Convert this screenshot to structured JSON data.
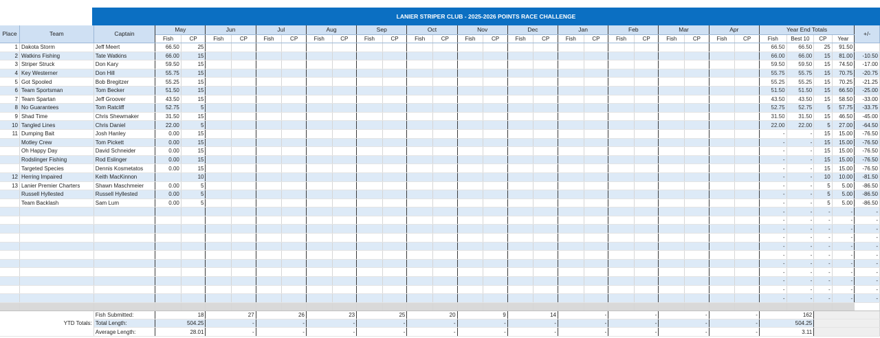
{
  "title": "LANIER STRIPER CLUB - 2025-2026 POINTS RACE CHALLENGE",
  "headers": {
    "place": "Place",
    "team": "Team",
    "captain": "Captain",
    "year_end_totals": "Year End Totals",
    "plus_minus": "+/-",
    "fish": "Fish",
    "cp": "CP",
    "best10": "Best 10",
    "year": "Year"
  },
  "months": [
    "May",
    "Jun",
    "Jul",
    "Aug",
    "Sep",
    "Oct",
    "Nov",
    "Dec",
    "Jan",
    "Feb",
    "Mar",
    "Apr"
  ],
  "rows": [
    {
      "place": "1",
      "team": "Dakota Storm",
      "captain": "Jeff Meert",
      "fish": "66.50",
      "cp": "25",
      "ye_fish": "66.50",
      "best10": "66.50",
      "ye_cp": "25",
      "year": "91.50",
      "pm": ""
    },
    {
      "place": "2",
      "team": "Watkins Fishing",
      "captain": "Tate Watkins",
      "fish": "66.00",
      "cp": "15",
      "ye_fish": "66.00",
      "best10": "66.00",
      "ye_cp": "15",
      "year": "81.00",
      "pm": "-10.50"
    },
    {
      "place": "3",
      "team": "Striper Struck",
      "captain": "Don Kary",
      "fish": "59.50",
      "cp": "15",
      "ye_fish": "59.50",
      "best10": "59.50",
      "ye_cp": "15",
      "year": "74.50",
      "pm": "-17.00"
    },
    {
      "place": "4",
      "team": "Key Westerner",
      "captain": "Don Hill",
      "fish": "55.75",
      "cp": "15",
      "ye_fish": "55.75",
      "best10": "55.75",
      "ye_cp": "15",
      "year": "70.75",
      "pm": "-20.75"
    },
    {
      "place": "5",
      "team": "Got Spooled",
      "captain": "Bob Bregitzer",
      "fish": "55.25",
      "cp": "15",
      "ye_fish": "55.25",
      "best10": "55.25",
      "ye_cp": "15",
      "year": "70.25",
      "pm": "-21.25"
    },
    {
      "place": "6",
      "team": "Team Sportsman",
      "captain": "Tom Becker",
      "fish": "51.50",
      "cp": "15",
      "ye_fish": "51.50",
      "best10": "51.50",
      "ye_cp": "15",
      "year": "66.50",
      "pm": "-25.00"
    },
    {
      "place": "7",
      "team": "Team Spartan",
      "captain": "Jeff Groover",
      "fish": "43.50",
      "cp": "15",
      "ye_fish": "43.50",
      "best10": "43.50",
      "ye_cp": "15",
      "year": "58.50",
      "pm": "-33.00"
    },
    {
      "place": "8",
      "team": "No Guarantees",
      "captain": "Tom Ratcliff",
      "fish": "52.75",
      "cp": "5",
      "ye_fish": "52.75",
      "best10": "52.75",
      "ye_cp": "5",
      "year": "57.75",
      "pm": "-33.75"
    },
    {
      "place": "9",
      "team": "Shad Time",
      "captain": "Chris Shewmaker",
      "fish": "31.50",
      "cp": "15",
      "ye_fish": "31.50",
      "best10": "31.50",
      "ye_cp": "15",
      "year": "46.50",
      "pm": "-45.00"
    },
    {
      "place": "10",
      "team": "Tangled Lines",
      "captain": "Chris Daniel",
      "fish": "22.00",
      "cp": "5",
      "ye_fish": "22.00",
      "best10": "22.00",
      "ye_cp": "5",
      "year": "27.00",
      "pm": "-64.50"
    },
    {
      "place": "11",
      "team": "Dumping Bait",
      "captain": "Josh Hanley",
      "fish": "0.00",
      "cp": "15",
      "ye_fish": "-",
      "best10": "-",
      "ye_cp": "15",
      "year": "15.00",
      "pm": "-76.50"
    },
    {
      "place": "",
      "team": "Motley Crew",
      "captain": "Tom Pickett",
      "fish": "0.00",
      "cp": "15",
      "ye_fish": "-",
      "best10": "-",
      "ye_cp": "15",
      "year": "15.00",
      "pm": "-76.50"
    },
    {
      "place": "",
      "team": "Oh Happy Day",
      "captain": "David Schneider",
      "fish": "0.00",
      "cp": "15",
      "ye_fish": "-",
      "best10": "-",
      "ye_cp": "15",
      "year": "15.00",
      "pm": "-76.50"
    },
    {
      "place": "",
      "team": "Rodslinger Fishing",
      "captain": "Rod Eslinger",
      "fish": "0.00",
      "cp": "15",
      "ye_fish": "-",
      "best10": "-",
      "ye_cp": "15",
      "year": "15.00",
      "pm": "-76.50"
    },
    {
      "place": "",
      "team": "Targeted Species",
      "captain": "Dennis Kosmetatos",
      "fish": "0.00",
      "cp": "15",
      "ye_fish": "-",
      "best10": "-",
      "ye_cp": "15",
      "year": "15.00",
      "pm": "-76.50"
    },
    {
      "place": "12",
      "team": "Herring Impaired",
      "captain": "Keith MacKinnon",
      "fish": "",
      "cp": "10",
      "ye_fish": "-",
      "best10": "-",
      "ye_cp": "10",
      "year": "10.00",
      "pm": "-81.50"
    },
    {
      "place": "13",
      "team": "Lanier Premier Charters",
      "captain": "Shawn Maschmeier",
      "fish": "0.00",
      "cp": "5",
      "ye_fish": "-",
      "best10": "-",
      "ye_cp": "5",
      "year": "5.00",
      "pm": "-86.50"
    },
    {
      "place": "",
      "team": "Russell Hyllested",
      "captain": "Russell Hyllested",
      "fish": "0.00",
      "cp": "5",
      "ye_fish": "-",
      "best10": "-",
      "ye_cp": "5",
      "year": "5.00",
      "pm": "-86.50"
    },
    {
      "place": "",
      "team": "Team Backlash",
      "captain": "Sam Lum",
      "fish": "0.00",
      "cp": "5",
      "ye_fish": "-",
      "best10": "-",
      "ye_cp": "5",
      "year": "5.00",
      "pm": "-86.50"
    }
  ],
  "blank_rows_count": 11,
  "blank_marker": "-",
  "ytd": {
    "label": "YTD Totals:",
    "fish_submitted_label": "Fish Submitted:",
    "total_length_label": "Total Length:",
    "average_length_label": "Average Length:",
    "fish_submitted": [
      "18",
      "27",
      "26",
      "23",
      "25",
      "20",
      "9",
      "14",
      "-",
      "-",
      "-",
      "-"
    ],
    "total_length": [
      "504.25",
      "-",
      "-",
      "-",
      "-",
      "-",
      "-",
      "-",
      "-",
      "-",
      "-",
      "-"
    ],
    "average_length": [
      "28.01",
      "-",
      "-",
      "-",
      "-",
      "-",
      "-",
      "-",
      "-",
      "-",
      "-",
      "-"
    ],
    "ye_fish_submitted": "162",
    "ye_total_length": "504.25",
    "ye_average_length": "3.11"
  },
  "colors": {
    "banner": "#0b6fc2",
    "header_fill": "#cfe0f3",
    "alt_row": "#ddeaf7",
    "separator": "#d9d9d9"
  }
}
